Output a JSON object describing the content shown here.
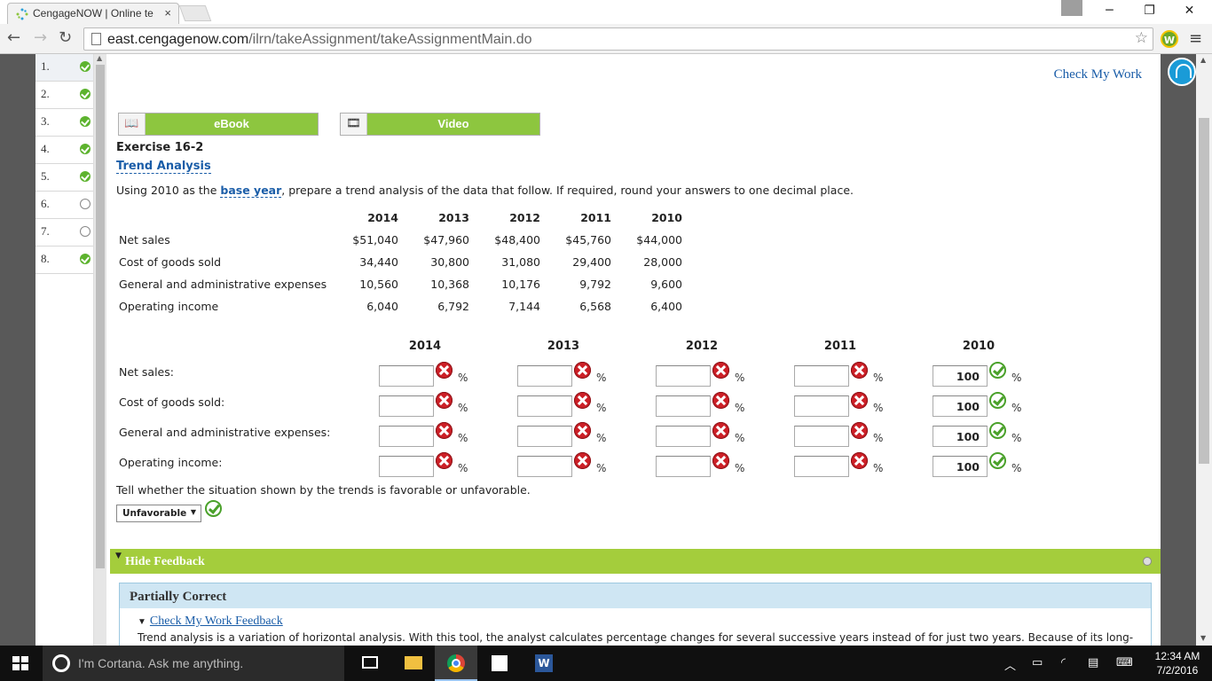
{
  "browser": {
    "tab_title": "CengageNOW | Online te",
    "tab_close": "×",
    "url_domain": "east.cengagenow.com",
    "url_path": "/ilrn/takeAssignment/takeAssignmentMain.do",
    "ext_label": "W",
    "win_min": "─",
    "win_max": "❐",
    "win_close": "✕"
  },
  "nav": {
    "items": [
      {
        "label": "1.",
        "status": "done"
      },
      {
        "label": "2.",
        "status": "done"
      },
      {
        "label": "3.",
        "status": "done"
      },
      {
        "label": "4.",
        "status": "done"
      },
      {
        "label": "5.",
        "status": "done"
      },
      {
        "label": "6.",
        "status": "open"
      },
      {
        "label": "7.",
        "status": "open"
      },
      {
        "label": "8.",
        "status": "done"
      }
    ]
  },
  "content": {
    "check_my_work": "Check My Work",
    "ebook_label": "eBook",
    "video_label": "Video",
    "exercise_number": "Exercise 16-2",
    "exercise_title": "Trend Analysis",
    "instr_pre": "Using 2010 as the ",
    "instr_kw": "base year",
    "instr_post": ", prepare a trend analysis of the data that follow. If required, round your answers to one decimal place."
  },
  "data_table": {
    "years": [
      "2014",
      "2013",
      "2012",
      "2011",
      "2010"
    ],
    "rows": [
      {
        "label": "Net sales",
        "values": [
          "$51,040",
          "$47,960",
          "$48,400",
          "$45,760",
          "$44,000"
        ]
      },
      {
        "label": "Cost of goods sold",
        "values": [
          "34,440",
          "30,800",
          "31,080",
          "29,400",
          "28,000"
        ]
      },
      {
        "label": "General and administrative expenses",
        "values": [
          "10,560",
          "10,368",
          "10,176",
          "9,792",
          "9,600"
        ]
      },
      {
        "label": "Operating income",
        "values": [
          "6,040",
          "6,792",
          "7,144",
          "6,568",
          "6,400"
        ]
      }
    ]
  },
  "answer_grid": {
    "years": [
      "2014",
      "2013",
      "2012",
      "2011",
      "2010"
    ],
    "percent_symbol": "%",
    "rows": [
      {
        "label": "Net sales:",
        "values": [
          "",
          "",
          "",
          "",
          "100"
        ],
        "marks": [
          "wrong",
          "wrong",
          "wrong",
          "wrong",
          "correct"
        ]
      },
      {
        "label": "Cost of goods sold:",
        "values": [
          "",
          "",
          "",
          "",
          "100"
        ],
        "marks": [
          "wrong",
          "wrong",
          "wrong",
          "wrong",
          "correct"
        ]
      },
      {
        "label": "General and administrative expenses:",
        "values": [
          "",
          "",
          "",
          "",
          "100"
        ],
        "marks": [
          "wrong",
          "wrong",
          "wrong",
          "wrong",
          "correct"
        ]
      },
      {
        "label": "Operating income:",
        "values": [
          "",
          "",
          "",
          "",
          "100"
        ],
        "marks": [
          "wrong",
          "wrong",
          "wrong",
          "wrong",
          "correct"
        ]
      }
    ]
  },
  "question2": {
    "text": "Tell whether the situation shown by the trends is favorable or unfavorable.",
    "selected": "Unfavorable",
    "mark": "correct"
  },
  "feedback": {
    "bar_label": "Hide Feedback",
    "status": "Partially Correct",
    "link": "Check My Work Feedback",
    "text": "Trend analysis is a variation of horizontal analysis. With this tool, the analyst calculates percentage changes for several successive years instead of for just two years. Because of its long-"
  },
  "taskbar": {
    "cortana_text": "I'm Cortana. Ask me anything.",
    "time": "12:34 AM",
    "date": "7/2/2016"
  },
  "colors": {
    "accent_green": "#8dc63f",
    "feedback_green": "#a4cd3c",
    "link_blue": "#1a5da8",
    "wrong_red": "#cc2027",
    "correct_green": "#4aa12a"
  }
}
